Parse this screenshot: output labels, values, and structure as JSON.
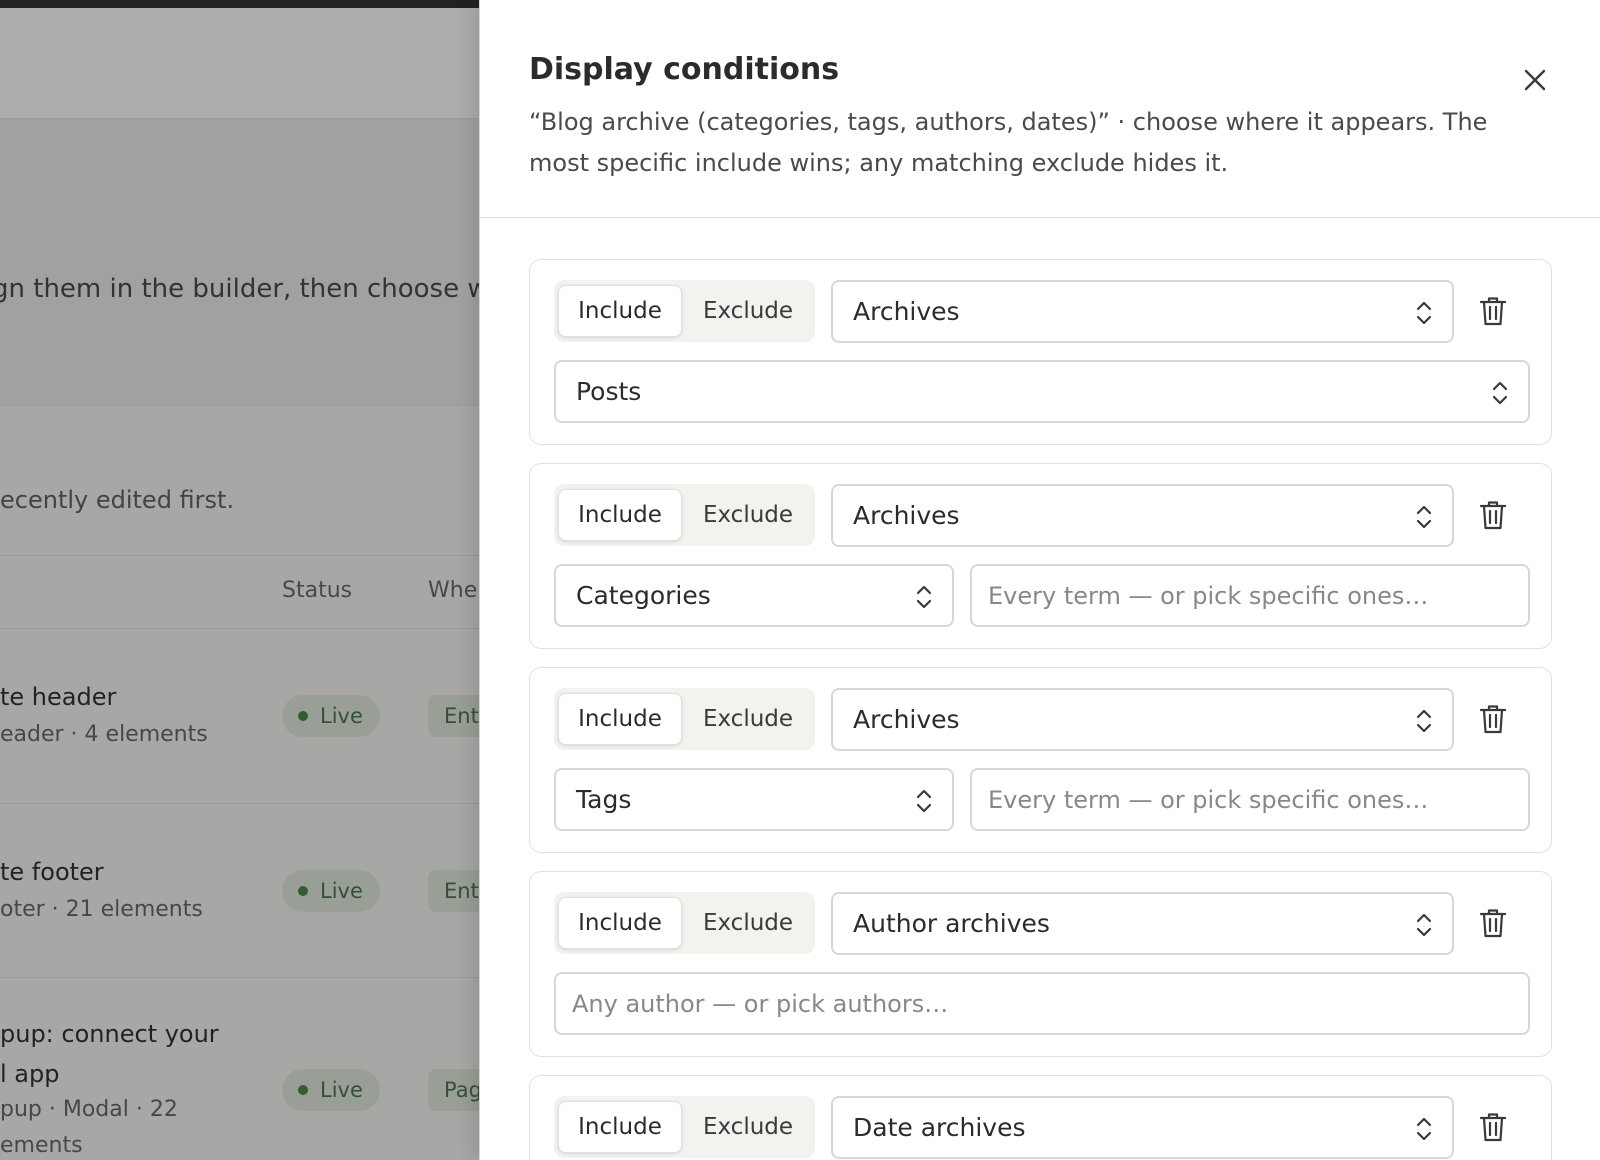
{
  "background": {
    "hero_text": "gn them in the builder, then choose wh",
    "list_subtitle": "ecently edited first.",
    "columns": {
      "status": "Status",
      "where": "Whe"
    },
    "rows": [
      {
        "title": "te header",
        "meta": "eader · 4 elements",
        "status": "Live",
        "where": "Ent"
      },
      {
        "title": "te footer",
        "meta": "oter · 21 elements",
        "status": "Live",
        "where": "Ent"
      },
      {
        "title_line1": "pup: connect your",
        "title_line2": "l app",
        "meta_line1": "pup · Modal · 22",
        "meta_line2": "ements",
        "status": "Live",
        "where": "Pag"
      }
    ]
  },
  "drawer": {
    "title": "Display conditions",
    "description": "“Blog archive (categories, tags, authors, dates)” · choose where it appears. The most specific include wins; any matching exclude hides it.",
    "include_label": "Include",
    "exclude_label": "Exclude",
    "rules": [
      {
        "mode": "Include",
        "type": "Archives",
        "sub_select": "Posts"
      },
      {
        "mode": "Include",
        "type": "Archives",
        "sub_select": "Categories",
        "term_placeholder": "Every term — or pick specific ones…"
      },
      {
        "mode": "Include",
        "type": "Archives",
        "sub_select": "Tags",
        "term_placeholder": "Every term — or pick specific ones…"
      },
      {
        "mode": "Include",
        "type": "Author archives",
        "author_placeholder": "Any author — or pick authors…"
      },
      {
        "mode": "Include",
        "type": "Date archives"
      }
    ]
  },
  "icons": [
    "close-icon",
    "chevron-updown-icon",
    "trash-icon"
  ],
  "colors": {
    "live_badge_bg": "#dfe8dc",
    "live_badge_text": "#3f6a3a",
    "scrim": "rgba(40,40,40,0.38)"
  }
}
